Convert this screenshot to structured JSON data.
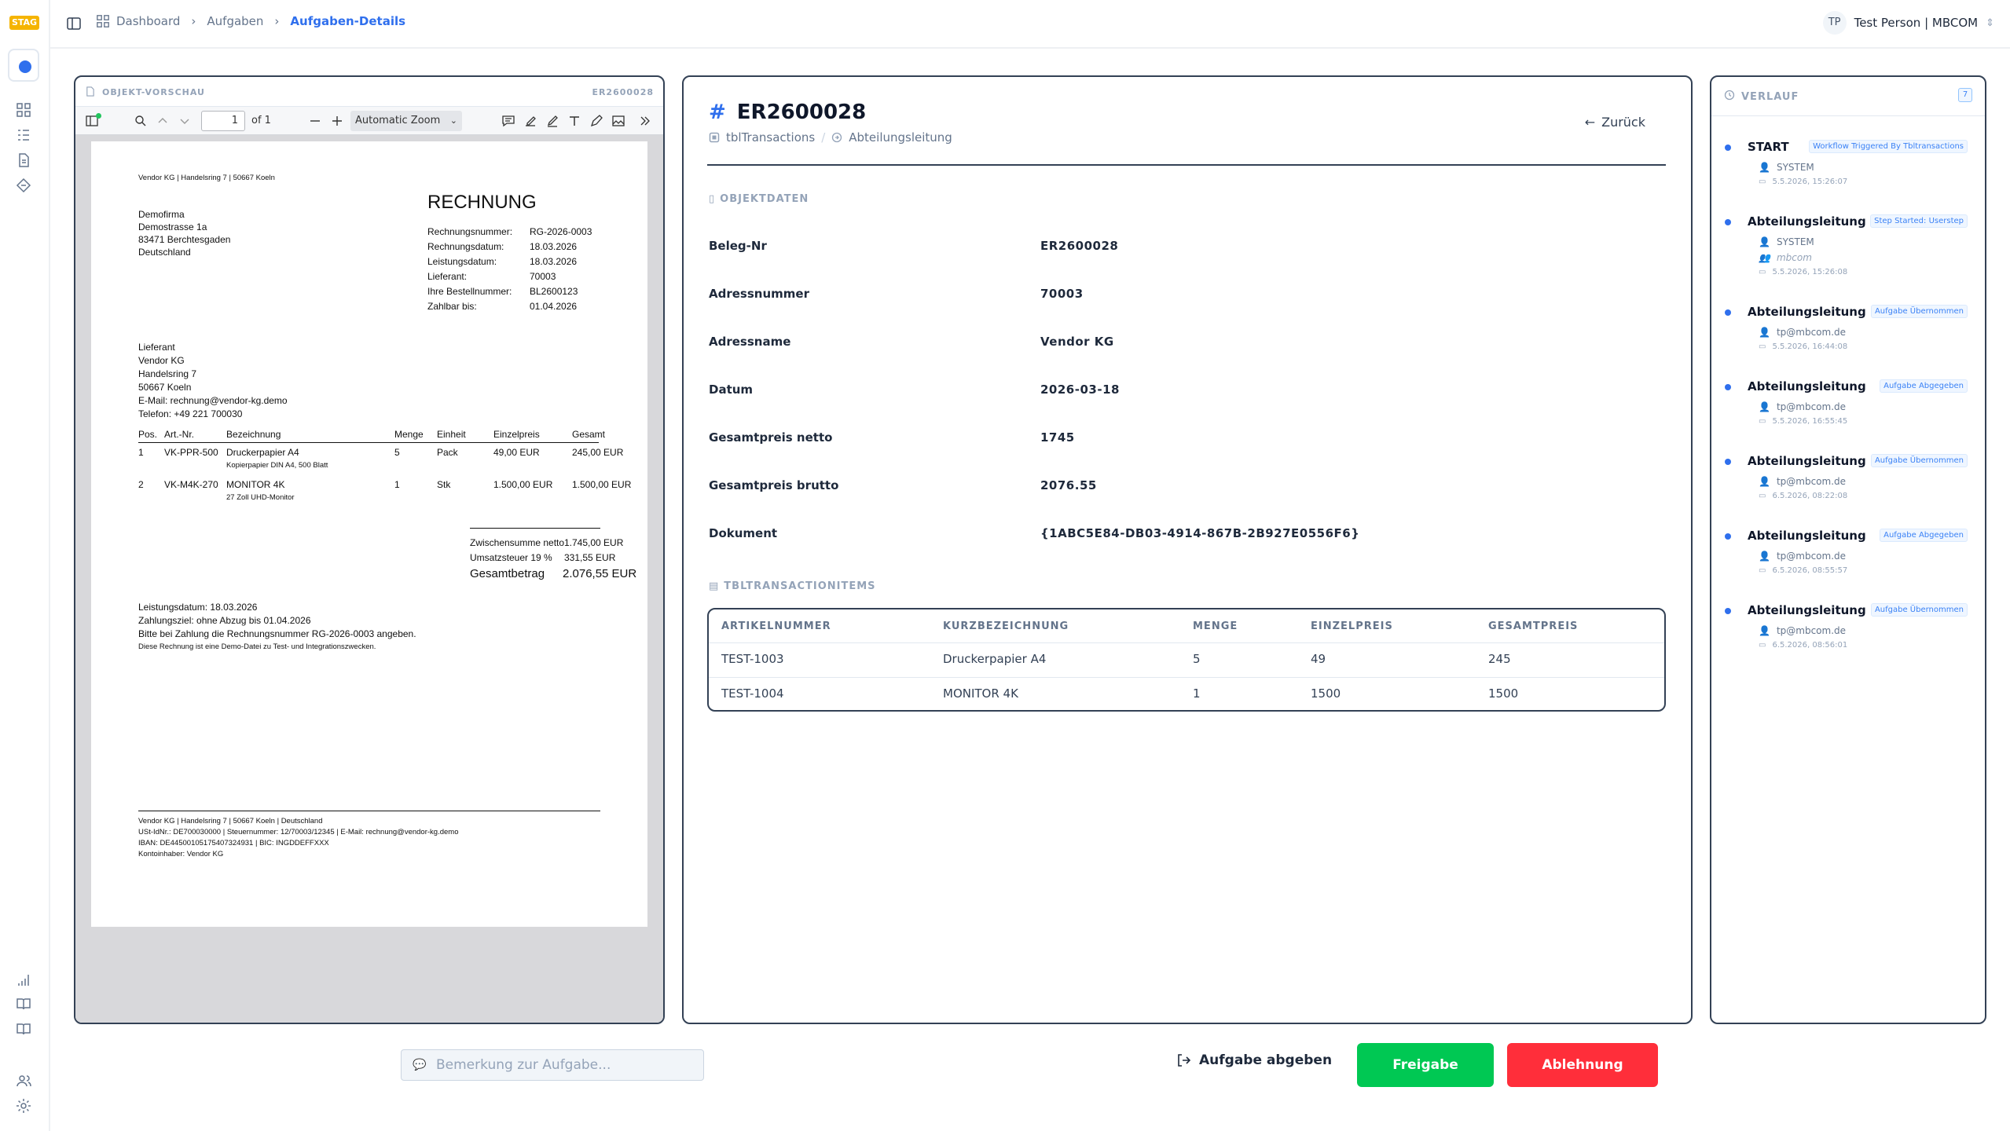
{
  "rail": {
    "env_badge": "STAG"
  },
  "breadcrumb": {
    "items": [
      "Dashboard",
      "Aufgaben"
    ],
    "current": "Aufgaben-Details"
  },
  "user": {
    "initials": "TP",
    "name": "Test Person | MBCOM"
  },
  "pdf": {
    "header_label": "OBJEKT-VORSCHAU",
    "header_id": "ER2600028",
    "page_value": "1",
    "page_of": "of 1",
    "zoom": "Automatic Zoom",
    "doc": {
      "sender_line": "Vendor KG | Handelsring 7 | 50667 Koeln",
      "recipient": [
        "Demofirma",
        "Demostrasse 1a",
        "83471 Berchtesgaden",
        "Deutschland"
      ],
      "title": "RECHNUNG",
      "meta": [
        {
          "k": "Rechnungsnummer:",
          "v": "RG-2026-0003"
        },
        {
          "k": "Rechnungsdatum:",
          "v": "18.03.2026"
        },
        {
          "k": "Leistungsdatum:",
          "v": "18.03.2026"
        },
        {
          "k": "Lieferant:",
          "v": "70003"
        },
        {
          "k": "Ihre Bestellnummer:",
          "v": "BL2600123"
        },
        {
          "k": "Zahlbar bis:",
          "v": "01.04.2026"
        }
      ],
      "supplier": [
        "Lieferant",
        "Vendor KG",
        "Handelsring 7",
        "50667 Koeln",
        "E-Mail: rechnung@vendor-kg.demo",
        "Telefon: +49 221 700030"
      ],
      "cols": [
        "Pos.",
        "Art.-Nr.",
        "Bezeichnung",
        "Menge",
        "Einheit",
        "Einzelpreis",
        "Gesamt"
      ],
      "rows": [
        {
          "pos": "1",
          "art": "VK-PPR-500",
          "bez": "Druckerpapier A4",
          "sub": "Kopierpapier DIN A4, 500 Blatt",
          "menge": "5",
          "einheit": "Pack",
          "ep": "49,00 EUR",
          "gesamt": "245,00 EUR"
        },
        {
          "pos": "2",
          "art": "VK-M4K-270",
          "bez": "MONITOR 4K",
          "sub": "27 Zoll UHD-Monitor",
          "menge": "1",
          "einheit": "Stk",
          "ep": "1.500,00 EUR",
          "gesamt": "1.500,00 EUR"
        }
      ],
      "sum_netto_label": "Zwischensumme netto",
      "sum_netto": "1.745,00 EUR",
      "ust_label": "Umsatzsteuer 19 %",
      "ust": "331,55 EUR",
      "total_label": "Gesamtbetrag",
      "total": "2.076,55 EUR",
      "notes": [
        "Leistungsdatum: 18.03.2026",
        "Zahlungsziel: ohne Abzug bis 01.04.2026",
        "Bitte bei Zahlung die Rechnungsnummer RG-2026-0003 angeben.",
        "Diese Rechnung ist eine Demo-Datei zu Test- und Integrationszwecken."
      ],
      "footer": [
        "Vendor KG | Handelsring 7 | 50667 Koeln | Deutschland",
        "USt-IdNr.: DE700030000 | Steuernummer: 12/70003/12345 | E-Mail: rechnung@vendor-kg.demo",
        "IBAN: DE44500105175407324931 | BIC: INGDDEFFXXX",
        "Kontoinhaber: Vendor KG"
      ]
    }
  },
  "main": {
    "hash": "#",
    "title": "ER2600028",
    "sub_table": "tblTransactions",
    "sub_sep": "/",
    "sub_step": "Abteilungsleitung",
    "back_label": "Zurück",
    "section_object": "OBJEKTDATEN",
    "fields": [
      {
        "label": "Beleg-Nr",
        "value": "ER2600028"
      },
      {
        "label": "Adressnummer",
        "value": "70003"
      },
      {
        "label": "Adressname",
        "value": "Vendor KG"
      },
      {
        "label": "Datum",
        "value": "2026-03-18"
      },
      {
        "label": "Gesamtpreis netto",
        "value": "1745"
      },
      {
        "label": "Gesamtpreis brutto",
        "value": "2076.55"
      },
      {
        "label": "Dokument",
        "value": "{1ABC5E84-DB03-4914-867B-2B927E0556F6}"
      }
    ],
    "section_items": "TBLTRANSACTIONITEMS",
    "items_headers": [
      "ARTIKELNUMMER",
      "KURZBEZEICHNUNG",
      "MENGE",
      "EINZELPREIS",
      "GESAMTPREIS"
    ],
    "items_rows": [
      [
        "TEST-1003",
        "Druckerpapier A4",
        "5",
        "49",
        "245"
      ],
      [
        "TEST-1004",
        "MONITOR 4K",
        "1",
        "1500",
        "1500"
      ]
    ]
  },
  "history": {
    "title": "VERLAUF",
    "count": "7",
    "items": [
      {
        "title": "START",
        "badge": "Workflow Triggered By Tbltransactions",
        "user": "SYSTEM",
        "date": "5.5.2026, 15:26:07"
      },
      {
        "title": "Abteilungsleitung",
        "badge": "Step Started: Userstep",
        "user": "SYSTEM",
        "group": "mbcom",
        "date": "5.5.2026, 15:26:08"
      },
      {
        "title": "Abteilungsleitung",
        "badge": "Aufgabe Übernommen",
        "user": "tp@mbcom.de",
        "date": "5.5.2026, 16:44:08"
      },
      {
        "title": "Abteilungsleitung",
        "badge": "Aufgabe Abgegeben",
        "user": "tp@mbcom.de",
        "date": "5.5.2026, 16:55:45"
      },
      {
        "title": "Abteilungsleitung",
        "badge": "Aufgabe Übernommen",
        "user": "tp@mbcom.de",
        "date": "6.5.2026, 08:22:08"
      },
      {
        "title": "Abteilungsleitung",
        "badge": "Aufgabe Abgegeben",
        "user": "tp@mbcom.de",
        "date": "6.5.2026, 08:55:57"
      },
      {
        "title": "Abteilungsleitung",
        "badge": "Aufgabe Übernommen",
        "user": "tp@mbcom.de",
        "date": "6.5.2026, 08:56:01"
      }
    ]
  },
  "footer": {
    "remark_placeholder": "Bemerkung zur Aufgabe...",
    "abgeben_label": "Aufgabe abgeben",
    "freigabe_label": "Freigabe",
    "ablehnung_label": "Ablehnung",
    "freigabe_color": "#00c853",
    "ablehnung_color": "#ff2e3a"
  }
}
